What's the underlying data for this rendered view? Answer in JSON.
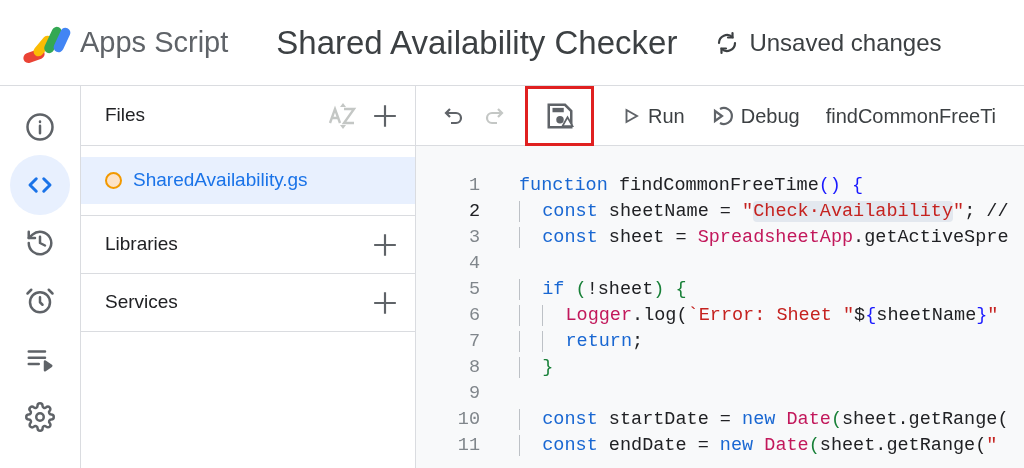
{
  "header": {
    "product": "Apps Script",
    "project_title": "Shared Availability Checker",
    "save_status": "Unsaved changes"
  },
  "rail": [
    {
      "selected": false
    },
    {
      "selected": true
    },
    {
      "selected": false
    },
    {
      "selected": false
    },
    {
      "selected": false
    },
    {
      "selected": false
    }
  ],
  "sidebar": {
    "files": {
      "title": "Files",
      "items": [
        {
          "name": "SharedAvailability.gs",
          "selected": true,
          "unsaved": true
        }
      ]
    },
    "sections": [
      {
        "title": "Libraries"
      },
      {
        "title": "Services"
      }
    ]
  },
  "toolbar": {
    "undo": {
      "disabled": false
    },
    "redo": {
      "disabled": true
    },
    "save_highlighted": true,
    "run": "Run",
    "debug": "Debug",
    "function_select": "findCommonFreeTi"
  },
  "editor": {
    "lines": [
      {
        "number": "1",
        "current": false,
        "tokens": [
          {
            "kind": "keyword",
            "text": "function"
          },
          {
            "kind": "plain",
            "text": " findCommonFreeTime"
          },
          {
            "kind": "bracket-a",
            "text": "()"
          },
          {
            "kind": "bracket-a",
            "text": " {"
          }
        ]
      },
      {
        "number": "2",
        "current": true,
        "tokens": [
          {
            "kind": "keyword",
            "text": "  const"
          },
          {
            "kind": "plain",
            "text": " sheetName = "
          },
          {
            "kind": "string",
            "text": "\""
          },
          {
            "kind": "string-match",
            "text": "Check·Availability"
          },
          {
            "kind": "string",
            "text": "\""
          },
          {
            "kind": "plain",
            "text": "; //"
          }
        ]
      },
      {
        "number": "3",
        "current": false,
        "tokens": [
          {
            "kind": "keyword",
            "text": "  const"
          },
          {
            "kind": "plain",
            "text": " sheet = "
          },
          {
            "kind": "class",
            "text": "SpreadsheetApp"
          },
          {
            "kind": "plain",
            "text": ".getActiveSpre"
          }
        ]
      },
      {
        "number": "4",
        "current": false
      },
      {
        "number": "5",
        "current": false,
        "tokens": [
          {
            "kind": "keyword",
            "text": "  if"
          },
          {
            "kind": "bracket-b",
            "text": " ("
          },
          {
            "kind": "plain",
            "text": "!sheet"
          },
          {
            "kind": "bracket-b",
            "text": ")"
          },
          {
            "kind": "bracket-b",
            "text": " {"
          }
        ]
      },
      {
        "number": "6",
        "current": false,
        "tokens": [
          {
            "kind": "class",
            "text": "    Logger"
          },
          {
            "kind": "plain",
            "text": ".log("
          },
          {
            "kind": "string",
            "text": "`Error: Sheet \""
          },
          {
            "kind": "plain",
            "text": "$"
          },
          {
            "kind": "bracket-a",
            "text": "{"
          },
          {
            "kind": "plain",
            "text": "sheetName"
          },
          {
            "kind": "bracket-a",
            "text": "}"
          },
          {
            "kind": "string",
            "text": "\""
          }
        ]
      },
      {
        "number": "7",
        "current": false,
        "tokens": [
          {
            "kind": "keyword",
            "text": "    return"
          },
          {
            "kind": "plain",
            "text": ";"
          }
        ]
      },
      {
        "number": "8",
        "current": false,
        "tokens": [
          {
            "kind": "bracket-b",
            "text": "  }"
          }
        ]
      },
      {
        "number": "9",
        "current": false
      },
      {
        "number": "10",
        "current": false,
        "tokens": [
          {
            "kind": "keyword",
            "text": "  const"
          },
          {
            "kind": "plain",
            "text": " startDate = "
          },
          {
            "kind": "keyword",
            "text": "new"
          },
          {
            "kind": "class",
            "text": " Date"
          },
          {
            "kind": "bracket-b",
            "text": "("
          },
          {
            "kind": "plain",
            "text": "sheet.getRange("
          }
        ]
      },
      {
        "number": "11",
        "current": false,
        "tokens": [
          {
            "kind": "keyword",
            "text": "  const"
          },
          {
            "kind": "plain",
            "text": " endDate = "
          },
          {
            "kind": "keyword",
            "text": "new"
          },
          {
            "kind": "class",
            "text": " Date"
          },
          {
            "kind": "bracket-b",
            "text": "("
          },
          {
            "kind": "plain",
            "text": "sheet.getRange("
          },
          {
            "kind": "string",
            "text": "\""
          }
        ]
      }
    ]
  }
}
